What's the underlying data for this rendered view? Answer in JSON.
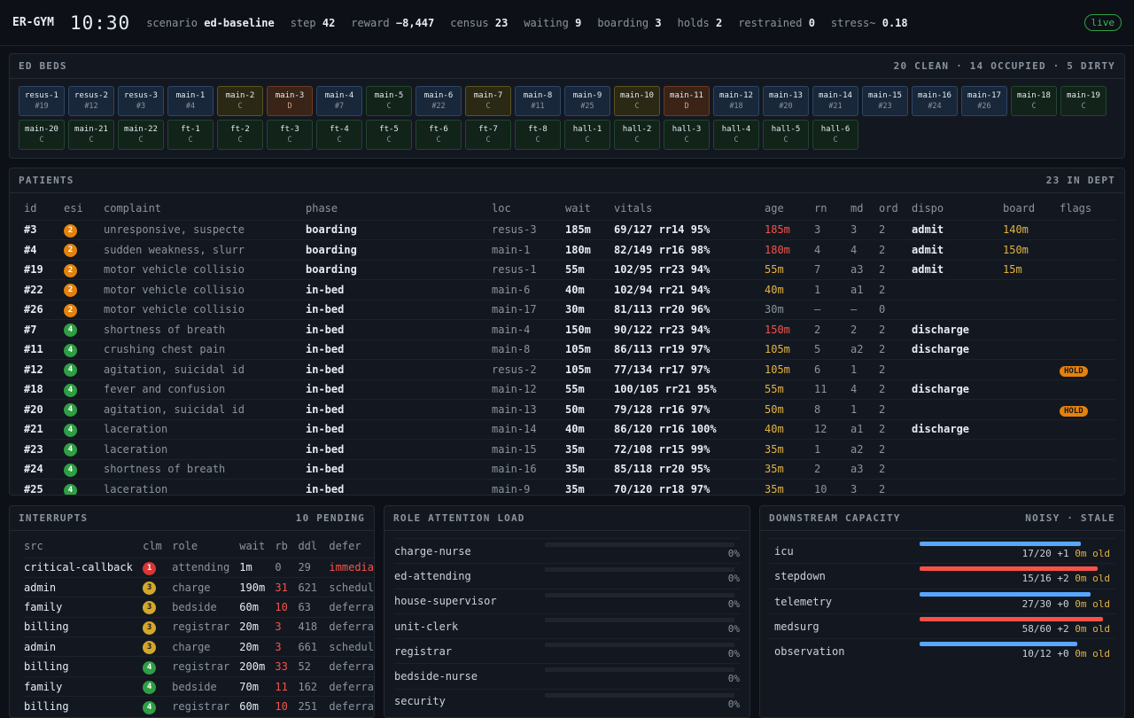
{
  "header": {
    "brand": "ER-GYM",
    "clock": "10:30",
    "stats": [
      {
        "label": "scenario",
        "value": "ed-baseline"
      },
      {
        "label": "step",
        "value": "42"
      },
      {
        "label": "reward",
        "value": "−8,447"
      },
      {
        "label": "census",
        "value": "23"
      },
      {
        "label": "waiting",
        "value": "9"
      },
      {
        "label": "boarding",
        "value": "3"
      },
      {
        "label": "holds",
        "value": "2"
      },
      {
        "label": "restrained",
        "value": "0"
      },
      {
        "label": "stress~",
        "value": "0.18"
      }
    ],
    "live": "live"
  },
  "beds": {
    "title": "ED BEDS",
    "summary": "20 CLEAN · 14 OCCUPIED · 5 DIRTY",
    "items": [
      {
        "name": "resus-1",
        "sub": "#19",
        "state": "occ"
      },
      {
        "name": "resus-2",
        "sub": "#12",
        "state": "occ"
      },
      {
        "name": "resus-3",
        "sub": "#3",
        "state": "occ"
      },
      {
        "name": "main-1",
        "sub": "#4",
        "state": "occ"
      },
      {
        "name": "main-2",
        "sub": "C",
        "state": "cln2"
      },
      {
        "name": "main-3",
        "sub": "D",
        "state": "dty"
      },
      {
        "name": "main-4",
        "sub": "#7",
        "state": "occ"
      },
      {
        "name": "main-5",
        "sub": "C",
        "state": "cln"
      },
      {
        "name": "main-6",
        "sub": "#22",
        "state": "occ"
      },
      {
        "name": "main-7",
        "sub": "C",
        "state": "cln2"
      },
      {
        "name": "main-8",
        "sub": "#11",
        "state": "occ"
      },
      {
        "name": "main-9",
        "sub": "#25",
        "state": "occ"
      },
      {
        "name": "main-10",
        "sub": "C",
        "state": "cln2"
      },
      {
        "name": "main-11",
        "sub": "D",
        "state": "dty"
      },
      {
        "name": "main-12",
        "sub": "#18",
        "state": "occ"
      },
      {
        "name": "main-13",
        "sub": "#20",
        "state": "occ"
      },
      {
        "name": "main-14",
        "sub": "#21",
        "state": "occ"
      },
      {
        "name": "main-15",
        "sub": "#23",
        "state": "occ"
      },
      {
        "name": "main-16",
        "sub": "#24",
        "state": "occ"
      },
      {
        "name": "main-17",
        "sub": "#26",
        "state": "occ"
      },
      {
        "name": "main-18",
        "sub": "C",
        "state": "cln"
      },
      {
        "name": "main-19",
        "sub": "C",
        "state": "cln"
      },
      {
        "name": "main-20",
        "sub": "C",
        "state": "cln"
      },
      {
        "name": "main-21",
        "sub": "C",
        "state": "cln"
      },
      {
        "name": "main-22",
        "sub": "C",
        "state": "cln"
      },
      {
        "name": "ft-1",
        "sub": "C",
        "state": "cln"
      },
      {
        "name": "ft-2",
        "sub": "C",
        "state": "cln"
      },
      {
        "name": "ft-3",
        "sub": "C",
        "state": "cln"
      },
      {
        "name": "ft-4",
        "sub": "C",
        "state": "cln"
      },
      {
        "name": "ft-5",
        "sub": "C",
        "state": "cln"
      },
      {
        "name": "ft-6",
        "sub": "C",
        "state": "cln"
      },
      {
        "name": "ft-7",
        "sub": "C",
        "state": "cln"
      },
      {
        "name": "ft-8",
        "sub": "C",
        "state": "cln"
      },
      {
        "name": "hall-1",
        "sub": "C",
        "state": "cln"
      },
      {
        "name": "hall-2",
        "sub": "C",
        "state": "cln"
      },
      {
        "name": "hall-3",
        "sub": "C",
        "state": "cln"
      },
      {
        "name": "hall-4",
        "sub": "C",
        "state": "cln"
      },
      {
        "name": "hall-5",
        "sub": "C",
        "state": "cln"
      },
      {
        "name": "hall-6",
        "sub": "C",
        "state": "cln"
      }
    ]
  },
  "patients": {
    "title": "PATIENTS",
    "summary": "23 IN DEPT",
    "columns": [
      "id",
      "esi",
      "complaint",
      "phase",
      "loc",
      "wait",
      "vitals",
      "age",
      "rn",
      "md",
      "ord",
      "dispo",
      "board",
      "flags"
    ],
    "rows": [
      [
        "#3",
        "2",
        "unresponsive, suspecte",
        "boarding",
        "resus-3",
        "185m",
        "69/127 rr14 95%",
        "185m",
        "3",
        "3",
        "2",
        "admit",
        "140m",
        ""
      ],
      [
        "#4",
        "2",
        "sudden weakness, slurr",
        "boarding",
        "main-1",
        "180m",
        "82/149 rr16 98%",
        "180m",
        "4",
        "4",
        "2",
        "admit",
        "150m",
        ""
      ],
      [
        "#19",
        "2",
        "motor vehicle collisio",
        "boarding",
        "resus-1",
        "55m",
        "102/95 rr23 94%",
        "55m",
        "7",
        "a3",
        "2",
        "admit",
        "15m",
        ""
      ],
      [
        "#22",
        "2",
        "motor vehicle collisio",
        "in-bed",
        "main-6",
        "40m",
        "102/94 rr21 94%",
        "40m",
        "1",
        "a1",
        "2",
        "",
        "",
        ""
      ],
      [
        "#26",
        "2",
        "motor vehicle collisio",
        "in-bed",
        "main-17",
        "30m",
        "81/113 rr20 96%",
        "30m",
        "—",
        "—",
        "0",
        "",
        "",
        ""
      ],
      [
        "#7",
        "4",
        "shortness of breath",
        "in-bed",
        "main-4",
        "150m",
        "90/122 rr23 94%",
        "150m",
        "2",
        "2",
        "2",
        "discharge",
        "",
        ""
      ],
      [
        "#11",
        "4",
        "crushing chest pain",
        "in-bed",
        "main-8",
        "105m",
        "86/113 rr19 97%",
        "105m",
        "5",
        "a2",
        "2",
        "discharge",
        "",
        ""
      ],
      [
        "#12",
        "4",
        "agitation, suicidal id",
        "in-bed",
        "resus-2",
        "105m",
        "77/134 rr17 97%",
        "105m",
        "6",
        "1",
        "2",
        "",
        "",
        "HOLD"
      ],
      [
        "#18",
        "4",
        "fever and confusion",
        "in-bed",
        "main-12",
        "55m",
        "100/105 rr21 95%",
        "55m",
        "11",
        "4",
        "2",
        "discharge",
        "",
        ""
      ],
      [
        "#20",
        "4",
        "agitation, suicidal id",
        "in-bed",
        "main-13",
        "50m",
        "79/128 rr16 97%",
        "50m",
        "8",
        "1",
        "2",
        "",
        "",
        "HOLD"
      ],
      [
        "#21",
        "4",
        "laceration",
        "in-bed",
        "main-14",
        "40m",
        "86/120 rr16 100%",
        "40m",
        "12",
        "a1",
        "2",
        "discharge",
        "",
        ""
      ],
      [
        "#23",
        "4",
        "laceration",
        "in-bed",
        "main-15",
        "35m",
        "72/108 rr15 99%",
        "35m",
        "1",
        "a2",
        "2",
        "",
        "",
        ""
      ],
      [
        "#24",
        "4",
        "shortness of breath",
        "in-bed",
        "main-16",
        "35m",
        "85/118 rr20 95%",
        "35m",
        "2",
        "a3",
        "2",
        "",
        "",
        ""
      ],
      [
        "#25",
        "4",
        "laceration",
        "in-bed",
        "main-9",
        "35m",
        "70/120 rr18 97%",
        "35m",
        "10",
        "3",
        "2",
        "",
        "",
        ""
      ]
    ]
  },
  "interrupts": {
    "title": "INTERRUPTS",
    "summary": "10 PENDING",
    "columns": [
      "src",
      "clm",
      "role",
      "wait",
      "rb",
      "ddl",
      "defer"
    ],
    "rows": [
      [
        "critical-callback",
        "1",
        "attending",
        "1m",
        "0",
        "29",
        "immedia"
      ],
      [
        "admin",
        "3",
        "charge",
        "190m",
        "31",
        "621",
        "schedul"
      ],
      [
        "family",
        "3",
        "bedside",
        "60m",
        "10",
        "63",
        "deferra"
      ],
      [
        "billing",
        "3",
        "registrar",
        "20m",
        "3",
        "418",
        "deferra"
      ],
      [
        "admin",
        "3",
        "charge",
        "20m",
        "3",
        "661",
        "schedul"
      ],
      [
        "billing",
        "4",
        "registrar",
        "200m",
        "33",
        "52",
        "deferra"
      ],
      [
        "family",
        "4",
        "bedside",
        "70m",
        "11",
        "162",
        "deferra"
      ],
      [
        "billing",
        "4",
        "registrar",
        "60m",
        "10",
        "251",
        "deferra"
      ]
    ]
  },
  "roles": {
    "title": "ROLE ATTENTION LOAD",
    "items": [
      {
        "name": "charge-nurse",
        "pct": "0%"
      },
      {
        "name": "ed-attending",
        "pct": "0%"
      },
      {
        "name": "house-supervisor",
        "pct": "0%"
      },
      {
        "name": "unit-clerk",
        "pct": "0%"
      },
      {
        "name": "registrar",
        "pct": "0%"
      },
      {
        "name": "bedside-nurse",
        "pct": "0%"
      },
      {
        "name": "security",
        "pct": "0%"
      }
    ]
  },
  "downstream": {
    "title": "DOWNSTREAM CAPACITY",
    "summary": "NOISY · STALE",
    "items": [
      {
        "name": "icu",
        "occ": 17,
        "cap": 20,
        "val": "17/20 +1",
        "age": "0m old",
        "color": "#58a6ff"
      },
      {
        "name": "stepdown",
        "occ": 15,
        "cap": 16,
        "val": "15/16 +2",
        "age": "0m old",
        "color": "#f85149"
      },
      {
        "name": "telemetry",
        "occ": 27,
        "cap": 30,
        "val": "27/30 +0",
        "age": "0m old",
        "color": "#58a6ff"
      },
      {
        "name": "medsurg",
        "occ": 58,
        "cap": 60,
        "val": "58/60 +2",
        "age": "0m old",
        "color": "#f85149"
      },
      {
        "name": "observation",
        "occ": 10,
        "cap": 12,
        "val": "10/12 +0",
        "age": "0m old",
        "color": "#58a6ff"
      }
    ]
  }
}
